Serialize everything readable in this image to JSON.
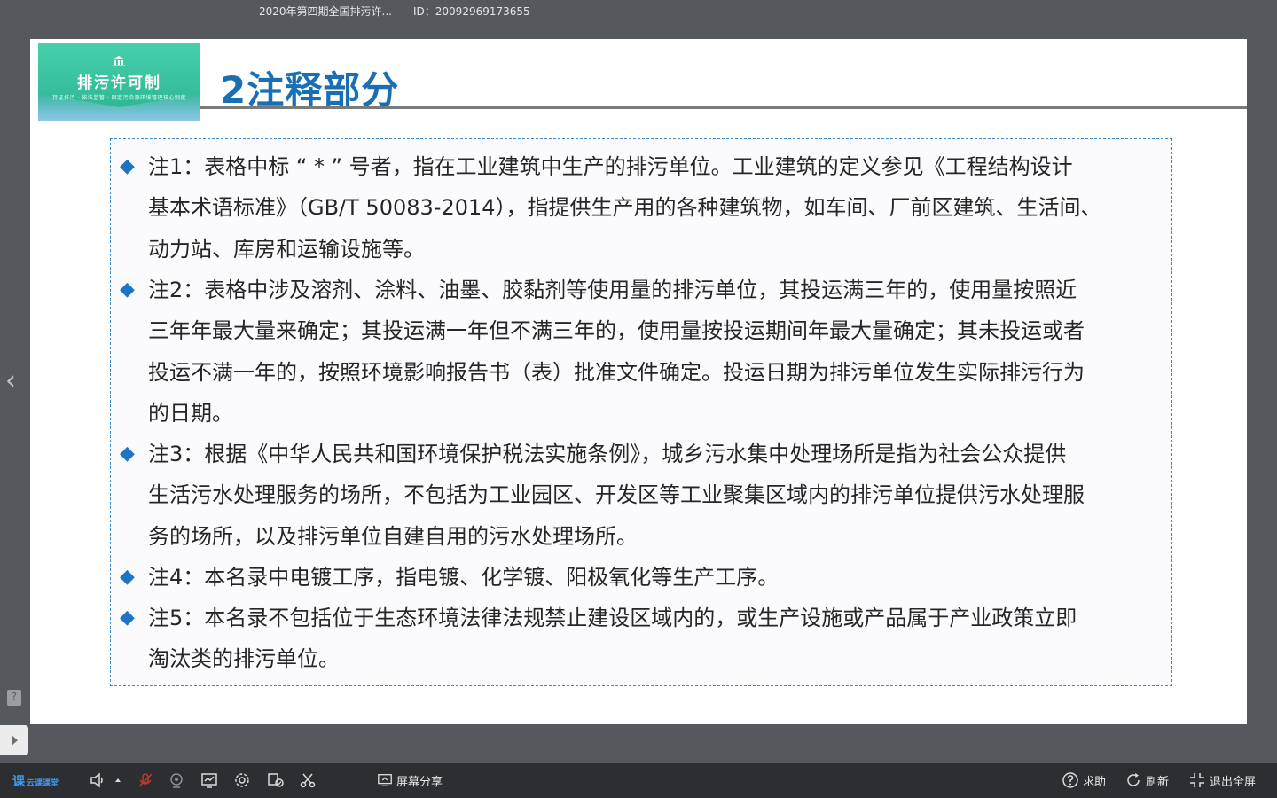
{
  "topbar": {
    "title": "2020年第四期全国排污许...",
    "meeting_id": "ID：20092969173655"
  },
  "slide": {
    "logo_text": "排污许可制",
    "logo_sub": "持证排污 · 依法监管 · 固定污染源环境管理核心制度",
    "title": "2注释部分",
    "notes": [
      {
        "bullet": "◆",
        "lines": [
          "注1：表格中标 “ * ” 号者，指在工业建筑中生产的排污单位。工业建筑的定义参见《工程结构设计",
          "基本术语标准》（GB/T 50083-2014），指提供生产用的各种建筑物，如车间、厂前区建筑、生活间、",
          "动力站、库房和运输设施等。"
        ]
      },
      {
        "bullet": "◆",
        "lines": [
          "注2：表格中涉及溶剂、涂料、油墨、胶黏剂等使用量的排污单位，其投运满三年的，使用量按照近",
          "三年年最大量来确定；其投运满一年但不满三年的，使用量按投运期间年最大量确定；其未投运或者",
          "投运不满一年的，按照环境影响报告书（表）批准文件确定。投运日期为排污单位发生实际排污行为",
          "的日期。"
        ]
      },
      {
        "bullet": "◆",
        "lines": [
          "注3：根据《中华人民共和国环境保护税法实施条例》，城乡污水集中处理场所是指为社会公众提供",
          "生活污水处理服务的场所，不包括为工业园区、开发区等工业聚集区域内的排污单位提供污水处理服",
          "务的场所，以及排污单位自建自用的污水处理场所。"
        ]
      },
      {
        "bullet": "◆",
        "lines": [
          "注4：本名录中电镀工序，指电镀、化学镀、阳极氧化等生产工序。"
        ]
      },
      {
        "bullet": "◆",
        "lines": [
          "注5：本名录不包括位于生态环境法律法规禁止建设区域内的，或生产设施或产品属于产业政策立即",
          "淘汰类的排污单位。"
        ]
      }
    ]
  },
  "nav": {
    "prev": "‹"
  },
  "toolbar": {
    "app_logo": "课",
    "app_name": "云课课堂",
    "screen_share": "屏幕分享",
    "help": "求助",
    "refresh": "刷新",
    "exit_fullscreen": "退出全屏"
  }
}
